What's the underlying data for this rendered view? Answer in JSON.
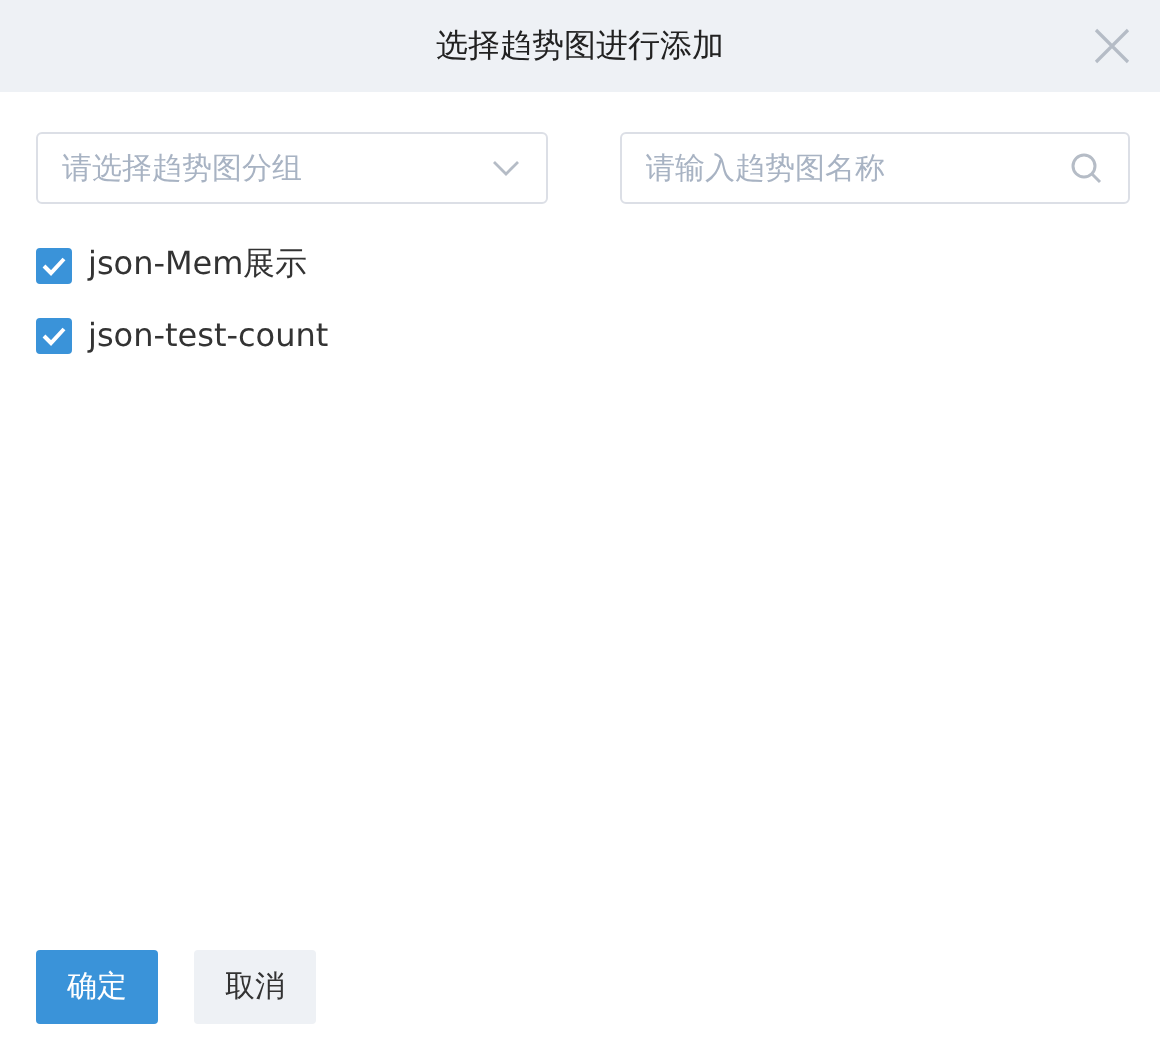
{
  "dialog": {
    "title": "选择趋势图进行添加"
  },
  "group_select": {
    "placeholder": "请选择趋势图分组"
  },
  "search": {
    "placeholder": "请输入趋势图名称"
  },
  "items": [
    {
      "label": "json-Mem展示",
      "checked": true
    },
    {
      "label": "json-test-count",
      "checked": true
    }
  ],
  "buttons": [
    {
      "label": "确定",
      "kind": "primary"
    },
    {
      "label": "取消",
      "kind": "secondary"
    }
  ]
}
